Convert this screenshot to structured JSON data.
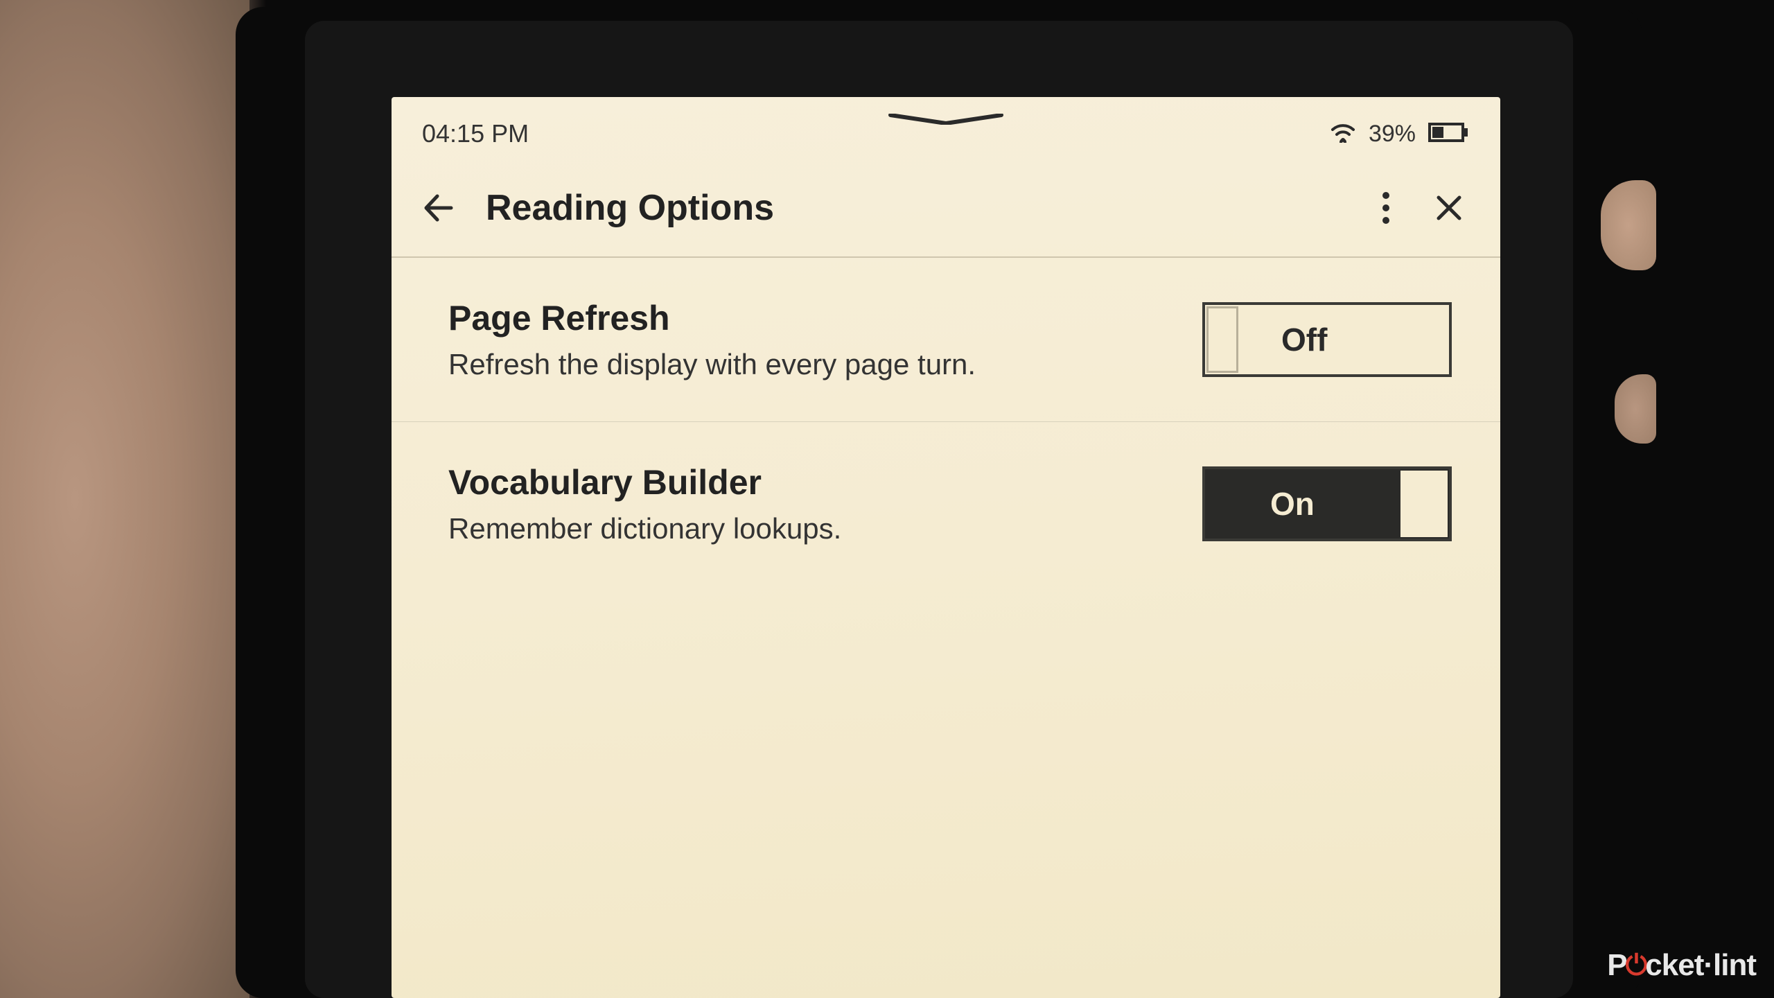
{
  "status": {
    "time": "04:15 PM",
    "battery_percent": "39%"
  },
  "header": {
    "title": "Reading Options"
  },
  "settings": [
    {
      "title": "Page Refresh",
      "description": "Refresh the display with every page turn.",
      "state_label": "Off",
      "on": false
    },
    {
      "title": "Vocabulary Builder",
      "description": "Remember dictionary lookups.",
      "state_label": "On",
      "on": true
    }
  ],
  "watermark": {
    "prefix": "P",
    "accent": "⏻",
    "suffix": "cket·lint"
  }
}
